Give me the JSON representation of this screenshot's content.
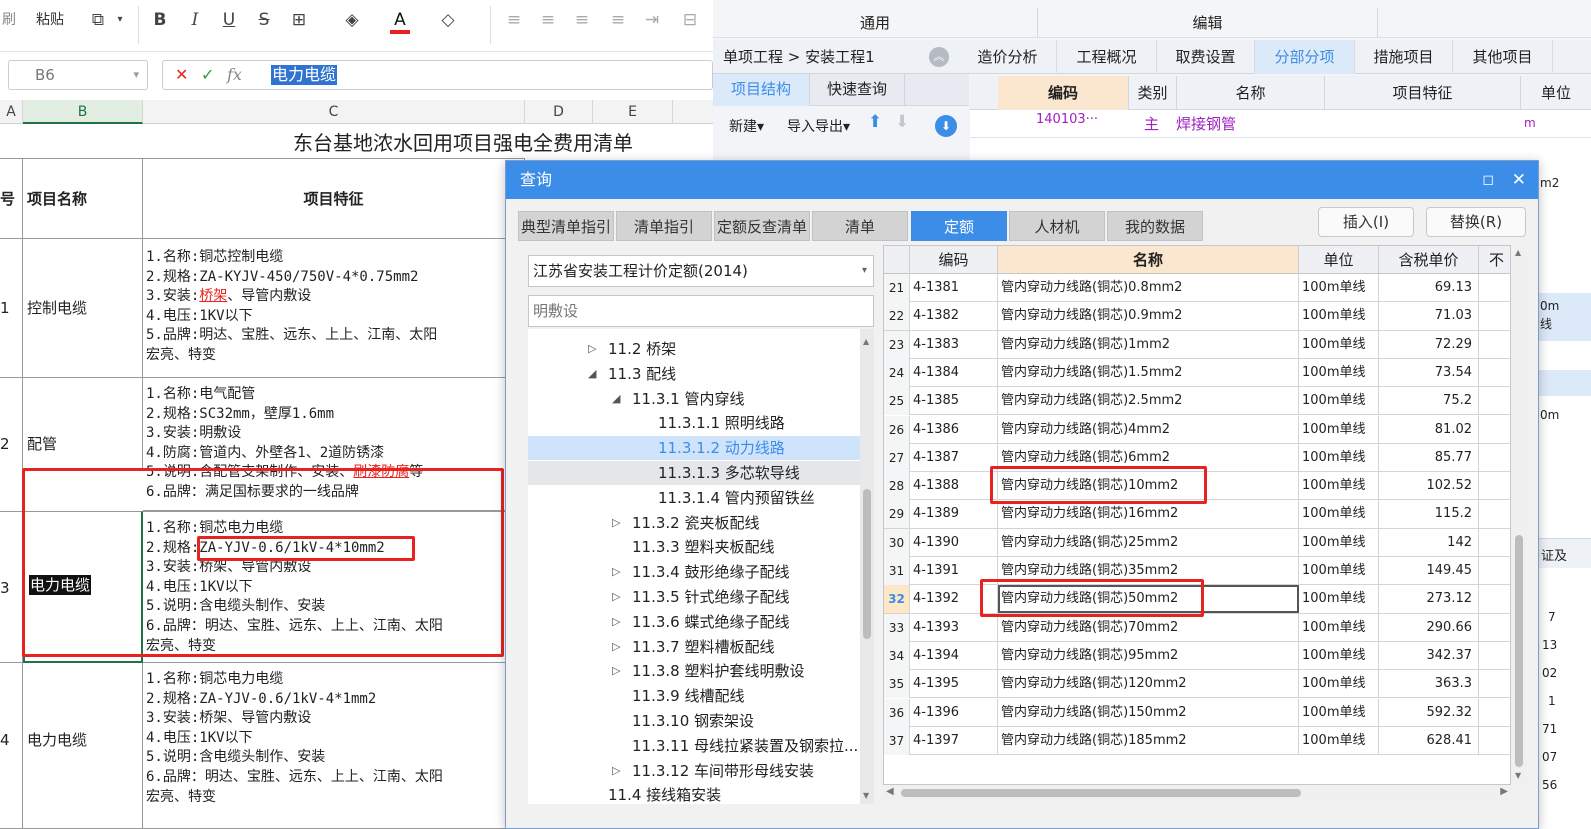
{
  "ribbon": {
    "brush_label": "刷",
    "paste_label": "粘贴",
    "bold": "B",
    "italic": "I",
    "underline": "U",
    "strike": "S",
    "font_color_letter": "A"
  },
  "formula_bar": {
    "cell_ref": "B6",
    "cancel": "✕",
    "confirm": "✓",
    "fx": "fx",
    "value": "电力电缆"
  },
  "sheet": {
    "col_headers": [
      "A",
      "B",
      "C",
      "D",
      "E"
    ],
    "title": "东台基地浓水回用项目强电全费用清单",
    "header_no": "号",
    "header_name": "项目名称",
    "header_feature": "项目特征",
    "rows": [
      {
        "no": "1",
        "name": "控制电缆",
        "features": [
          "1.名称:铜芯控制电缆",
          "2.规格:ZA-KYJV-450/750V-4*0.75mm2",
          "3.安装:桥架、导管内敷设",
          "4.电压:1KV以下",
          "5.品牌:明达、宝胜、远东、上上、江南、太阳",
          "宏亮、特变"
        ]
      },
      {
        "no": "2",
        "name": "配管",
        "features": [
          "1.名称:电气配管",
          "2.规格:SC32mm，壁厚1.6mm",
          "3.安装:明敷设",
          "4.防腐:管道内、外壁各1、2道防锈漆",
          "5.说明:含配管支架制作、安装、刷漆防腐等",
          "6.品牌：满足国标要求的一线品牌"
        ]
      },
      {
        "no": "3",
        "name": "电力电缆",
        "features": [
          "1.名称:铜芯电力电缆",
          "2.规格:ZA-YJV-0.6/1kV-4*10mm2",
          "3.安装:桥架、导管内敷设",
          "4.电压:1KV以下",
          "5.说明:含电缆头制作、安装",
          "6.品牌：明达、宝胜、远东、上上、江南、太阳",
          "宏亮、特变"
        ]
      },
      {
        "no": "4",
        "name": "电力电缆",
        "features": [
          "1.名称:铜芯电力电缆",
          "2.规格:ZA-YJV-0.6/1kV-4*1mm2",
          "3.安装:桥架、导管内敷设",
          "4.电压:1KV以下",
          "5.说明:含电缆头制作、安装",
          "6.品牌：明达、宝胜、远东、上上、江南、太阳",
          "宏亮、特变"
        ]
      }
    ]
  },
  "glodon": {
    "top_groups": [
      "通用",
      "编辑"
    ],
    "breadcrumb": "单项工程 > 安装工程1",
    "tabs": [
      "造价分析",
      "工程概况",
      "取费设置",
      "分部分项",
      "措施项目",
      "其他项目"
    ],
    "active_tab": "分部分项",
    "left_tabs": [
      "项目结构",
      "快速查询"
    ],
    "toolbar": [
      "新建▾",
      "导入导出▾"
    ],
    "grid_headers": [
      "编码",
      "类别",
      "名称",
      "项目特征",
      "单位"
    ],
    "grid_row": {
      "code": "140103···",
      "type": "主",
      "name": "焊接钢管",
      "unit": "m"
    },
    "side_fragments": [
      "m2",
      "0m",
      "线",
      "0m",
      "证及",
      "7",
      "13",
      "02",
      "1",
      "71",
      "07",
      "56"
    ]
  },
  "dialog": {
    "title": "查询",
    "tabs": [
      "典型清单指引",
      "清单指引",
      "定额反查清单",
      "清单",
      "定额",
      "人材机",
      "我的数据"
    ],
    "active_tab": "定额",
    "insert_button": "插入(I)",
    "replace_button": "替换(R)",
    "quota_select": "江苏省安装工程计价定额(2014)",
    "search_placeholder": "明敷设",
    "tree": [
      {
        "label": "11.2 桥架",
        "level": 0,
        "arrow": "▷"
      },
      {
        "label": "11.3 配线",
        "level": 0,
        "arrow": "◢"
      },
      {
        "label": "11.3.1 管内穿线",
        "level": 1,
        "arrow": "◢"
      },
      {
        "label": "11.3.1.1 照明线路",
        "level": 2,
        "arrow": ""
      },
      {
        "label": "11.3.1.2 动力线路",
        "level": 2,
        "arrow": ""
      },
      {
        "label": "11.3.1.3 多芯软导线",
        "level": 2,
        "arrow": ""
      },
      {
        "label": "11.3.1.4 管内预留铁丝",
        "level": 2,
        "arrow": ""
      },
      {
        "label": "11.3.2 瓷夹板配线",
        "level": 1,
        "arrow": "▷"
      },
      {
        "label": "11.3.3 塑料夹板配线",
        "level": 1,
        "arrow": ""
      },
      {
        "label": "11.3.4 鼓形绝缘子配线",
        "level": 1,
        "arrow": "▷"
      },
      {
        "label": "11.3.5 针式绝缘子配线",
        "level": 1,
        "arrow": "▷"
      },
      {
        "label": "11.3.6 蝶式绝缘子配线",
        "level": 1,
        "arrow": "▷"
      },
      {
        "label": "11.3.7 塑料槽板配线",
        "level": 1,
        "arrow": "▷"
      },
      {
        "label": "11.3.8 塑料护套线明敷设",
        "level": 1,
        "arrow": "▷"
      },
      {
        "label": "11.3.9 线槽配线",
        "level": 1,
        "arrow": ""
      },
      {
        "label": "11.3.10 钢索架设",
        "level": 1,
        "arrow": ""
      },
      {
        "label": "11.3.11 母线拉紧装置及钢索拉...",
        "level": 1,
        "arrow": ""
      },
      {
        "label": "11.3.12 车间带形母线安装",
        "level": 1,
        "arrow": "▷"
      },
      {
        "label": "11.4 接线箱安装",
        "level": 0,
        "arrow": ""
      }
    ],
    "table_headers": [
      "编码",
      "名称",
      "单位",
      "含税单价",
      "不"
    ],
    "rows": [
      {
        "n": "21",
        "code": "4-1381",
        "name": "管内穿动力线路(铜芯)0.8mm2",
        "unit": "100m单线",
        "price": "69.13"
      },
      {
        "n": "22",
        "code": "4-1382",
        "name": "管内穿动力线路(铜芯)0.9mm2",
        "unit": "100m单线",
        "price": "71.03"
      },
      {
        "n": "23",
        "code": "4-1383",
        "name": "管内穿动力线路(铜芯)1mm2",
        "unit": "100m单线",
        "price": "72.29"
      },
      {
        "n": "24",
        "code": "4-1384",
        "name": "管内穿动力线路(铜芯)1.5mm2",
        "unit": "100m单线",
        "price": "73.54"
      },
      {
        "n": "25",
        "code": "4-1385",
        "name": "管内穿动力线路(铜芯)2.5mm2",
        "unit": "100m单线",
        "price": "75.2"
      },
      {
        "n": "26",
        "code": "4-1386",
        "name": "管内穿动力线路(铜芯)4mm2",
        "unit": "100m单线",
        "price": "81.02"
      },
      {
        "n": "27",
        "code": "4-1387",
        "name": "管内穿动力线路(铜芯)6mm2",
        "unit": "100m单线",
        "price": "85.77"
      },
      {
        "n": "28",
        "code": "4-1388",
        "name": "管内穿动力线路(铜芯)10mm2",
        "unit": "100m单线",
        "price": "102.52"
      },
      {
        "n": "29",
        "code": "4-1389",
        "name": "管内穿动力线路(铜芯)16mm2",
        "unit": "100m单线",
        "price": "115.2"
      },
      {
        "n": "30",
        "code": "4-1390",
        "name": "管内穿动力线路(铜芯)25mm2",
        "unit": "100m单线",
        "price": "142"
      },
      {
        "n": "31",
        "code": "4-1391",
        "name": "管内穿动力线路(铜芯)35mm2",
        "unit": "100m单线",
        "price": "149.45"
      },
      {
        "n": "32",
        "code": "4-1392",
        "name": "管内穿动力线路(铜芯)50mm2",
        "unit": "100m单线",
        "price": "273.12"
      },
      {
        "n": "33",
        "code": "4-1393",
        "name": "管内穿动力线路(铜芯)70mm2",
        "unit": "100m单线",
        "price": "290.66"
      },
      {
        "n": "34",
        "code": "4-1394",
        "name": "管内穿动力线路(铜芯)95mm2",
        "unit": "100m单线",
        "price": "342.37"
      },
      {
        "n": "35",
        "code": "4-1395",
        "name": "管内穿动力线路(铜芯)120mm2",
        "unit": "100m单线",
        "price": "363.3"
      },
      {
        "n": "36",
        "code": "4-1396",
        "name": "管内穿动力线路(铜芯)150mm2",
        "unit": "100m单线",
        "price": "592.32"
      },
      {
        "n": "37",
        "code": "4-1397",
        "name": "管内穿动力线路(铜芯)185mm2",
        "unit": "100m单线",
        "price": "628.41"
      }
    ]
  },
  "colors": {
    "accent": "#3b8de8",
    "highlight_red": "#e8231f",
    "link_purple": "#a020c0",
    "selected_tree": "#cfe4fb"
  }
}
